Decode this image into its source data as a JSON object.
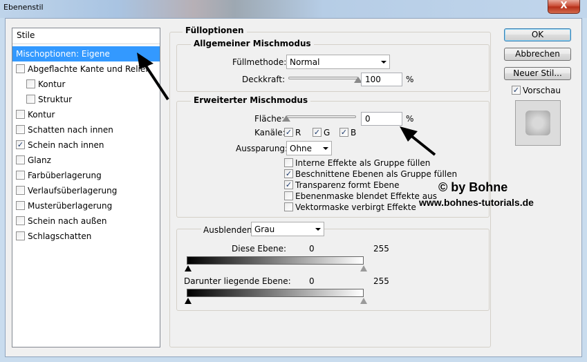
{
  "window": {
    "title": "Ebenenstil",
    "close_glyph": "X"
  },
  "styles_panel": {
    "header": "Stile",
    "items": [
      {
        "label": "Mischoptionen: Eigene",
        "checkbox": false,
        "selected": true
      },
      {
        "label": "Abgeflachte Kante und Relief",
        "checkbox": true,
        "checked": false
      },
      {
        "label": "Kontur",
        "checkbox": true,
        "checked": false,
        "sub": true
      },
      {
        "label": "Struktur",
        "checkbox": true,
        "checked": false,
        "sub": true
      },
      {
        "label": "Kontur",
        "checkbox": true,
        "checked": false
      },
      {
        "label": "Schatten nach innen",
        "checkbox": true,
        "checked": false
      },
      {
        "label": "Schein nach innen",
        "checkbox": true,
        "checked": true
      },
      {
        "label": "Glanz",
        "checkbox": true,
        "checked": false
      },
      {
        "label": "Farbüberlagerung",
        "checkbox": true,
        "checked": false
      },
      {
        "label": "Verlaufsüberlagerung",
        "checkbox": true,
        "checked": false
      },
      {
        "label": "Musterüberlagerung",
        "checkbox": true,
        "checked": false
      },
      {
        "label": "Schein nach außen",
        "checkbox": true,
        "checked": false
      },
      {
        "label": "Schlagschatten",
        "checkbox": true,
        "checked": false
      }
    ]
  },
  "fill_options": {
    "title": "Fülloptionen",
    "general": {
      "title": "Allgemeiner Mischmodus",
      "blend_label": "Füllmethode:",
      "blend_value": "Normal",
      "opacity_label": "Deckkraft:",
      "opacity_value": "100",
      "opacity_unit": "%",
      "opacity_level": 1.0
    },
    "advanced": {
      "title": "Erweiterter Mischmodus",
      "fill_label": "Fläche:",
      "fill_value": "0",
      "fill_unit": "%",
      "fill_level": 0.0,
      "channels_label": "Kanäle:",
      "channels": [
        {
          "name": "R",
          "checked": true
        },
        {
          "name": "G",
          "checked": true
        },
        {
          "name": "B",
          "checked": true
        }
      ],
      "knockout_label": "Aussparung:",
      "knockout_value": "Ohne",
      "options": [
        {
          "label": "Interne Effekte als Gruppe füllen",
          "checked": false
        },
        {
          "label": "Beschnittene Ebenen als Gruppe füllen",
          "checked": true
        },
        {
          "label": "Transparenz formt Ebene",
          "checked": true
        },
        {
          "label": "Ebenenmaske blendet Effekte aus",
          "checked": false
        },
        {
          "label": "Vektormaske verbirgt Effekte",
          "checked": false
        }
      ]
    },
    "blend_if": {
      "label": "Ausblenden:",
      "value": "Grau",
      "this_layer": {
        "label": "Diese Ebene:",
        "min": "0",
        "max": "255"
      },
      "underlying": {
        "label": "Darunter liegende Ebene:",
        "min": "0",
        "max": "255"
      }
    }
  },
  "buttons": {
    "ok": "OK",
    "cancel": "Abbrechen",
    "new_style": "Neuer Stil..."
  },
  "preview": {
    "label": "Vorschau",
    "checked": true
  },
  "watermark": {
    "line1": "© by Bohne",
    "line2": "www.bohnes-tutorials.de"
  },
  "check_glyph": "✓",
  "colors": {
    "selection": "#3399ff",
    "accent_arrow": "#000000"
  }
}
